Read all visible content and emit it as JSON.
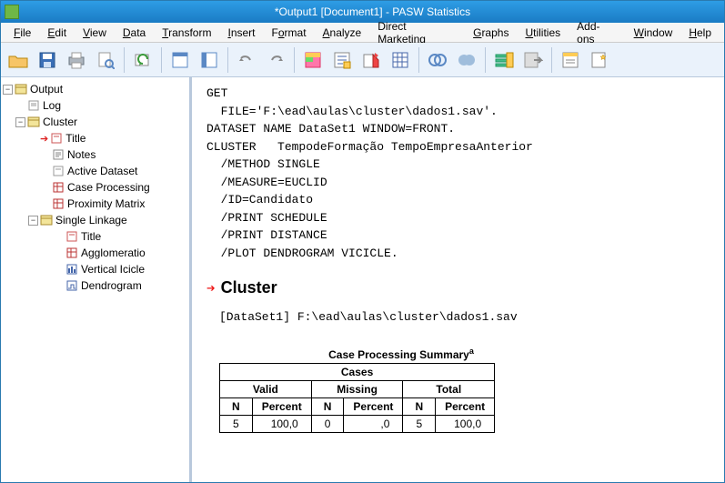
{
  "titlebar": "*Output1 [Document1] - PASW Statistics",
  "menus": {
    "file": "File",
    "edit": "Edit",
    "view": "View",
    "data": "Data",
    "transform": "Transform",
    "insert": "Insert",
    "format": "Format",
    "analyze": "Analyze",
    "direct_marketing": "Direct Marketing",
    "graphs": "Graphs",
    "utilities": "Utilities",
    "addons": "Add-ons",
    "window": "Window",
    "help": "Help"
  },
  "outline": {
    "root": "Output",
    "log": "Log",
    "cluster": "Cluster",
    "title": "Title",
    "notes": "Notes",
    "active_dataset": "Active Dataset",
    "case_processing": "Case Processing",
    "proximity_matrix": "Proximity Matrix",
    "single_linkage": "Single Linkage",
    "sl_title": "Title",
    "sl_agglom": "Agglomeratio",
    "sl_vicicle": "Vertical Icicle",
    "sl_dendrogram": "Dendrogram"
  },
  "syntax": {
    "l1": "GET",
    "l2": "  FILE='F:\\ead\\aulas\\cluster\\dados1.sav'.",
    "l3": "DATASET NAME DataSet1 WINDOW=FRONT.",
    "l4": "CLUSTER   TempodeFormação TempoEmpresaAnterior",
    "l5": "  /METHOD SINGLE",
    "l6": "  /MEASURE=EUCLID",
    "l7": "  /ID=Candidato",
    "l8": "  /PRINT SCHEDULE",
    "l9": "  /PRINT DISTANCE",
    "l10": "  /PLOT DENDROGRAM VICICLE."
  },
  "cluster_heading": "Cluster",
  "dataset_line": "[DataSet1] F:\\ead\\aulas\\cluster\\dados1.sav",
  "table": {
    "title": "Case Processing Summary",
    "sup": "a",
    "top": "Cases",
    "valid": "Valid",
    "missing": "Missing",
    "total": "Total",
    "n": "N",
    "percent": "Percent",
    "r": {
      "valid_n": "5",
      "valid_p": "100,0",
      "miss_n": "0",
      "miss_p": ",0",
      "total_n": "5",
      "total_p": "100,0"
    }
  }
}
